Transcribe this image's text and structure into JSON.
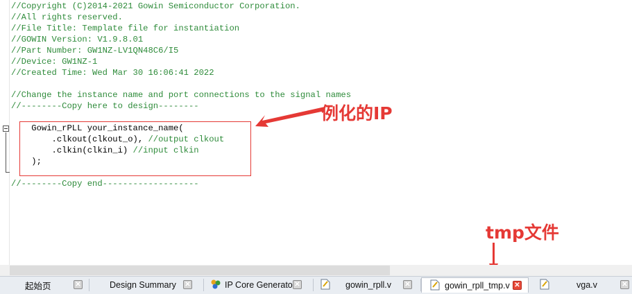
{
  "editor": {
    "lines": [
      {
        "text": "//Copyright (C)2014-2021 Gowin Semiconductor Corporation.",
        "kind": "comment"
      },
      {
        "text": "//All rights reserved.",
        "kind": "comment"
      },
      {
        "text": "//File Title: Template file for instantiation",
        "kind": "comment"
      },
      {
        "text": "//GOWIN Version: V1.9.8.01",
        "kind": "comment"
      },
      {
        "text": "//Part Number: GW1NZ-LV1QN48C6/I5",
        "kind": "comment"
      },
      {
        "text": "//Device: GW1NZ-1",
        "kind": "comment"
      },
      {
        "text": "//Created Time: Wed Mar 30 16:06:41 2022",
        "kind": "comment"
      },
      {
        "text": "",
        "kind": "blank"
      },
      {
        "text": "//Change the instance name and port connections to the signal names",
        "kind": "comment"
      },
      {
        "text": "//--------Copy here to design--------",
        "kind": "comment"
      },
      {
        "text": "",
        "kind": "blank"
      },
      {
        "text": "    Gowin_rPLL your_instance_name(",
        "kind": "code"
      },
      {
        "text": "        .clkout(clkout_o), ",
        "kind": "code",
        "comment": "//output clkout"
      },
      {
        "text": "        .clkin(clkin_i) ",
        "kind": "code",
        "comment": "//input clkin"
      },
      {
        "text": "    );",
        "kind": "code"
      },
      {
        "text": "",
        "kind": "blank"
      },
      {
        "text": "//--------Copy end-------------------",
        "kind": "comment"
      }
    ]
  },
  "annotations": {
    "instantiation_label": "例化的IP",
    "tmp_label": "tmp文件",
    "color": "#e53935"
  },
  "tabs": [
    {
      "label": "起始页",
      "icon": "none",
      "active": false
    },
    {
      "label": "Design Summary",
      "icon": "none",
      "active": false
    },
    {
      "label": "IP Core Generator",
      "icon": "ip-core-icon",
      "active": false
    },
    {
      "label": "gowin_rpll.v",
      "icon": "verilog-file-icon",
      "active": false
    },
    {
      "label": "gowin_rpll_tmp.v",
      "icon": "verilog-file-icon",
      "active": true
    },
    {
      "label": "vga.v",
      "icon": "verilog-file-icon",
      "active": false
    }
  ]
}
